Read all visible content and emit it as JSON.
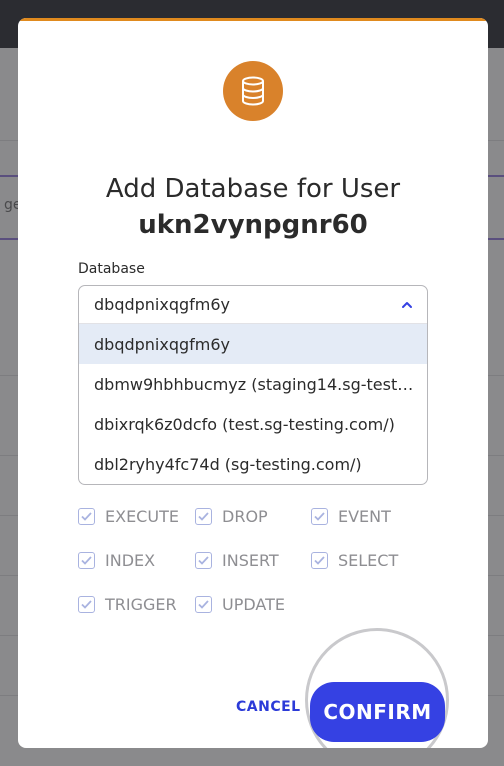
{
  "background": {
    "fragment_text": "ge"
  },
  "modal": {
    "icon": "database-icon",
    "title": "Add Database for User",
    "username": "ukn2vynpgnr60",
    "database_label": "Database",
    "selected_value": "dbqdpnixqgfm6y",
    "options": [
      {
        "label": "dbqdpnixqgfm6y",
        "selected": true
      },
      {
        "label": "dbmw9hbhbucmyz (staging14.sg-test…",
        "selected": false
      },
      {
        "label": "dbixrqk6z0dcfo (test.sg-testing.com/)",
        "selected": false
      },
      {
        "label": "dbl2ryhy4fc74d (sg-testing.com/)",
        "selected": false
      }
    ],
    "permissions": [
      {
        "label": "EXECUTE",
        "checked": true
      },
      {
        "label": "DROP",
        "checked": true
      },
      {
        "label": "EVENT",
        "checked": true
      },
      {
        "label": "INDEX",
        "checked": true
      },
      {
        "label": "INSERT",
        "checked": true
      },
      {
        "label": "SELECT",
        "checked": true
      },
      {
        "label": "TRIGGER",
        "checked": true
      },
      {
        "label": "UPDATE",
        "checked": true
      }
    ],
    "cancel_label": "CANCEL",
    "confirm_label": "CONFIRM"
  },
  "colors": {
    "accent_orange": "#d9822b",
    "primary_blue": "#3541e3",
    "link_blue": "#2c3bd8",
    "selected_option_bg": "#e4ebf6"
  }
}
